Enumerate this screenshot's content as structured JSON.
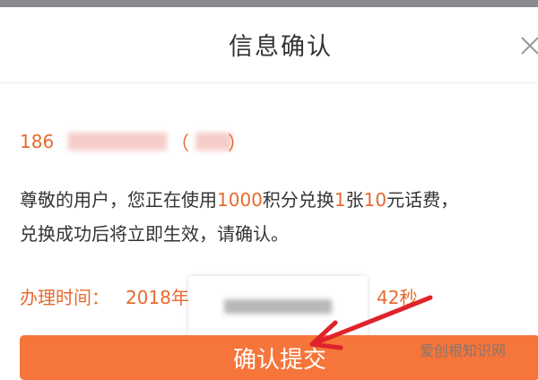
{
  "dialog": {
    "title": "信息确认",
    "close_icon": "close-icon"
  },
  "phone": {
    "prefix": "186",
    "paren_open": "（",
    "paren_close": "）"
  },
  "message": {
    "part1": "尊敬的用户，您正在使用",
    "points": "1000",
    "part2": "积分兑换",
    "count": "1",
    "part3": "张",
    "amount": "10",
    "part4": "元话费，",
    "line2": "兑换成功后将立即生效，请确认。"
  },
  "time": {
    "label": "办理时间：",
    "year": "2018年",
    "seconds": "42秒"
  },
  "confirm_button": {
    "label": "确认提交"
  },
  "annotation": {
    "arrow_color": "#e0232b"
  },
  "watermark": {
    "text": "爱创根知识网"
  },
  "colors": {
    "accent": "#e66a2e",
    "button": "#f6753a"
  }
}
